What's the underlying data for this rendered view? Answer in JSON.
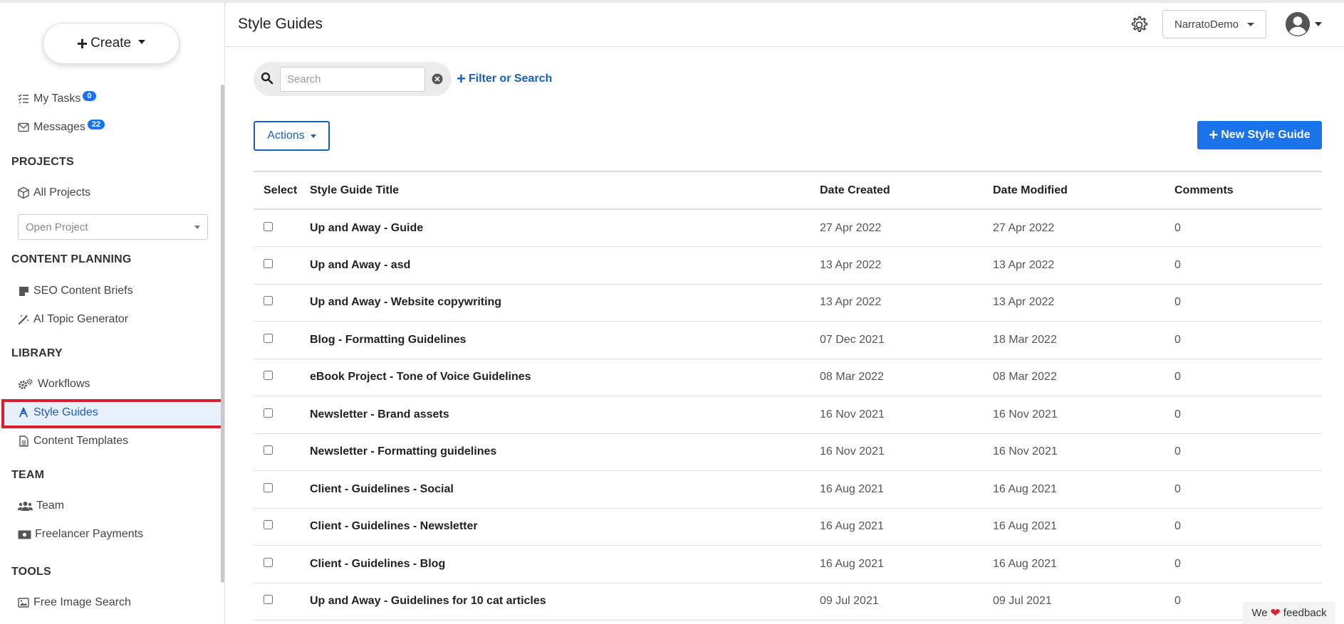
{
  "sidebar": {
    "create_label": "Create",
    "my_tasks": {
      "label": "My Tasks",
      "badge": "0"
    },
    "messages": {
      "label": "Messages",
      "badge": "22"
    },
    "projects_heading": "PROJECTS",
    "all_projects": "All Projects",
    "open_project_placeholder": "Open Project",
    "content_planning_heading": "CONTENT PLANNING",
    "seo_content_briefs": "SEO Content Briefs",
    "ai_topic_generator": "AI Topic Generator",
    "library_heading": "LIBRARY",
    "workflows": "Workflows",
    "style_guides": "Style Guides",
    "content_templates": "Content Templates",
    "team_heading": "TEAM",
    "team": "Team",
    "freelancer_payments": "Freelancer Payments",
    "tools_heading": "TOOLS",
    "free_image_search": "Free Image Search",
    "active_item": "Style Guides",
    "highlight_color": "#d9212b"
  },
  "header": {
    "title": "Style Guides",
    "account": "NarratoDemo"
  },
  "search": {
    "placeholder": "Search",
    "filter_label": "Filter or Search"
  },
  "toolbar": {
    "actions_label": "Actions",
    "new_label": "New Style Guide"
  },
  "table": {
    "columns": [
      "Select",
      "Style Guide Title",
      "Date Created",
      "Date Modified",
      "Comments"
    ],
    "rows": [
      {
        "title": "Up and Away - Guide",
        "created": "27 Apr 2022",
        "modified": "27 Apr 2022",
        "comments": "0"
      },
      {
        "title": "Up and Away - asd",
        "created": "13 Apr 2022",
        "modified": "13 Apr 2022",
        "comments": "0"
      },
      {
        "title": "Up and Away - Website copywriting",
        "created": "13 Apr 2022",
        "modified": "13 Apr 2022",
        "comments": "0"
      },
      {
        "title": "Blog - Formatting Guidelines",
        "created": "07 Dec 2021",
        "modified": "18 Mar 2022",
        "comments": "0"
      },
      {
        "title": "eBook Project - Tone of Voice Guidelines",
        "created": "08 Mar 2022",
        "modified": "08 Mar 2022",
        "comments": "0"
      },
      {
        "title": "Newsletter - Brand assets",
        "created": "16 Nov 2021",
        "modified": "16 Nov 2021",
        "comments": "0"
      },
      {
        "title": "Newsletter - Formatting guidelines",
        "created": "16 Nov 2021",
        "modified": "16 Nov 2021",
        "comments": "0"
      },
      {
        "title": "Client - Guidelines - Social",
        "created": "16 Aug 2021",
        "modified": "16 Aug 2021",
        "comments": "0"
      },
      {
        "title": "Client - Guidelines - Newsletter",
        "created": "16 Aug 2021",
        "modified": "16 Aug 2021",
        "comments": "0"
      },
      {
        "title": "Client - Guidelines - Blog",
        "created": "16 Aug 2021",
        "modified": "16 Aug 2021",
        "comments": "0"
      },
      {
        "title": "Up and Away - Guidelines for 10 cat articles",
        "created": "09 Jul 2021",
        "modified": "09 Jul 2021",
        "comments": "0"
      }
    ]
  },
  "feedback": {
    "prefix": "We",
    "suffix": "feedback"
  },
  "colors": {
    "primary": "#1a73e8",
    "link": "#1a5fb4",
    "badge": "#1a73e8"
  }
}
